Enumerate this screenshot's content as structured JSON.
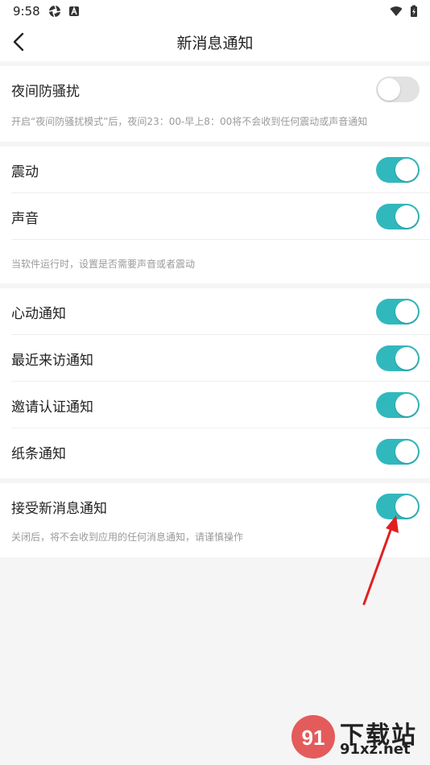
{
  "status_bar": {
    "time": "9:58"
  },
  "app_bar": {
    "title": "新消息通知"
  },
  "sections": {
    "night": {
      "label": "夜间防骚扰",
      "on": false,
      "hint": "开启“夜间防骚扰模式”后，夜间23：00-早上8：00将不会收到任何震动或声音通知"
    },
    "alerts": {
      "items": [
        {
          "label": "震动",
          "on": true
        },
        {
          "label": "声音",
          "on": true
        }
      ],
      "hint": "当软件运行时，设置是否需要声音或者震动"
    },
    "notifications": {
      "items": [
        {
          "label": "心动通知",
          "on": true
        },
        {
          "label": "最近来访通知",
          "on": true
        },
        {
          "label": "邀请认证通知",
          "on": true
        },
        {
          "label": "纸条通知",
          "on": true
        }
      ]
    },
    "receive": {
      "label": "接受新消息通知",
      "on": true,
      "hint": "关闭后，将不会收到应用的任何消息通知，请谨慎操作"
    }
  },
  "colors": {
    "toggle_on": "#31b8bd",
    "toggle_off": "#e2e2e2",
    "annotation_arrow": "#e02020"
  },
  "watermark": {
    "line1": "下载站",
    "line2": "91xz.net"
  }
}
